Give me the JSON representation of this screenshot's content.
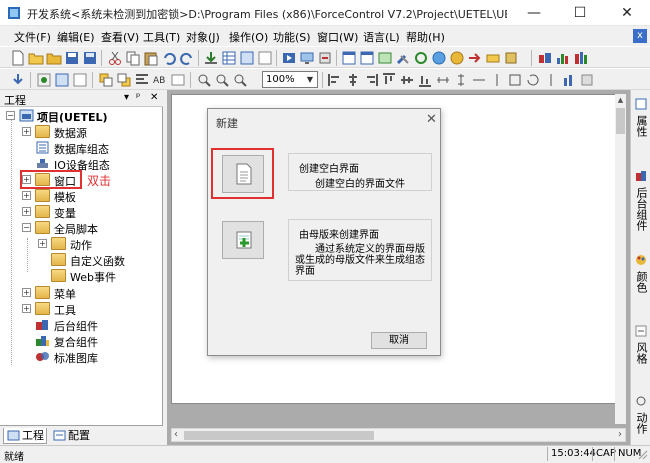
{
  "window": {
    "title": "开发系统<系统未检测到加密锁>D:\\Program Files (x86)\\ForceControl V7.2\\Project\\UETEL\\UETEL - 优易通水位...",
    "minimize": "—",
    "maximize": "☐",
    "close": "✕"
  },
  "menu": {
    "items": [
      "文件(F)",
      "编辑(E)",
      "查看(V)",
      "工具(T)",
      "对象(J)",
      "操作(O)",
      "功能(S)",
      "窗口(W)",
      "语言(L)",
      "帮助(H)"
    ],
    "mdi_close": "x"
  },
  "toolbar": {
    "zoom_value": "100%"
  },
  "left_panel": {
    "title": "工程",
    "pin": "▾ ᵖ ✕",
    "tree": [
      {
        "label": "项目(UETEL)",
        "bold": true
      },
      {
        "label": "数据源"
      },
      {
        "label": "数据库组态"
      },
      {
        "label": "IO设备组态"
      },
      {
        "label": "窗口"
      },
      {
        "label": "模板"
      },
      {
        "label": "变量"
      },
      {
        "label": "全局脚本"
      },
      {
        "label": "动作"
      },
      {
        "label": "自定义函数"
      },
      {
        "label": "Web事件"
      },
      {
        "label": "菜单"
      },
      {
        "label": "工具"
      },
      {
        "label": "后台组件"
      },
      {
        "label": "复合组件"
      },
      {
        "label": "标准图库"
      }
    ],
    "annotation": "双击",
    "tabs": [
      "工程",
      "配置"
    ]
  },
  "right_dock": {
    "tabs": [
      "属性",
      "后台组件",
      "颜色",
      "风格",
      "动作"
    ]
  },
  "dialog": {
    "title": "新建",
    "close": "✕",
    "option1": {
      "title": "创建空白界面",
      "desc": "创建空白的界面文件"
    },
    "option2": {
      "title": "由母版来创建界面",
      "desc_line1": "通过系统定义的界面母版",
      "desc_line2": "或生成的母版文件来生成组态",
      "desc_line3": "界面"
    },
    "cancel": "取消"
  },
  "statusbar": {
    "text": "就绪",
    "time": "15:03:44",
    "cap": "CAP",
    "num": "NUM"
  },
  "colors": {
    "annotation_red": "#e03030",
    "accent_blue": "#3a6ec8"
  }
}
